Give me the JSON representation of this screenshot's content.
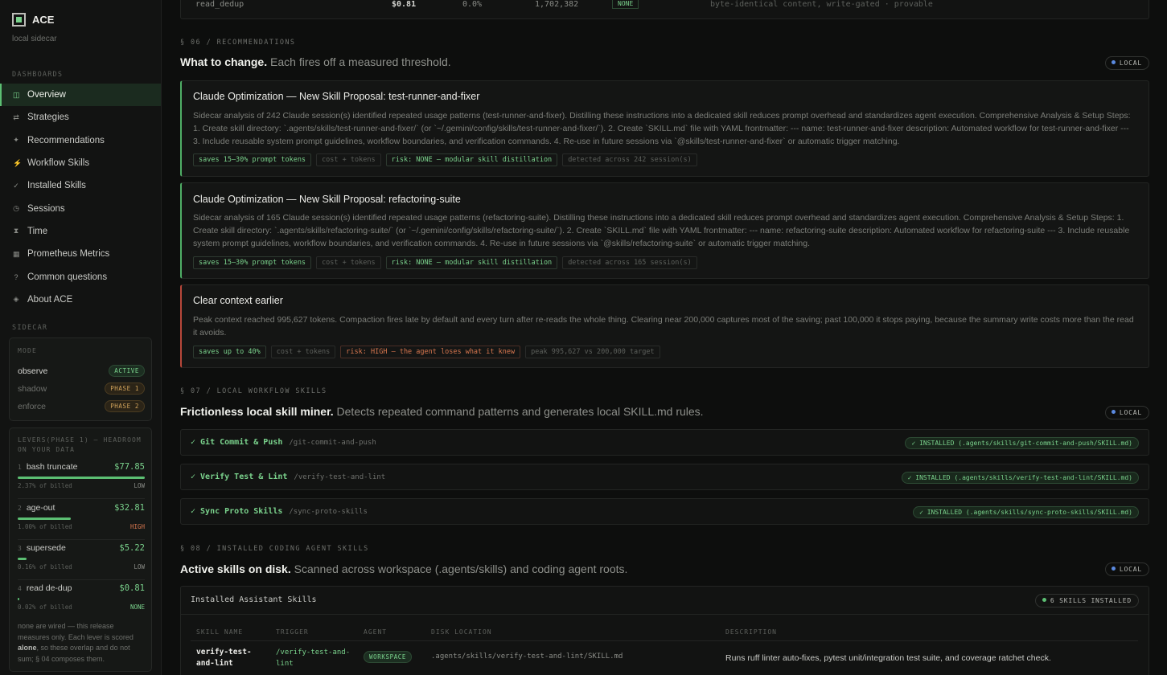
{
  "brand": {
    "title": "ACE",
    "subtitle": "local sidecar"
  },
  "sidebar": {
    "dashboards_label": "DASHBOARDS",
    "items": [
      {
        "label": "Overview",
        "icon": "grid-icon",
        "glyph": "◫"
      },
      {
        "label": "Strategies",
        "icon": "arrows-icon",
        "glyph": "⇄"
      },
      {
        "label": "Recommendations",
        "icon": "sparkle-icon",
        "glyph": "✦"
      },
      {
        "label": "Workflow Skills",
        "icon": "lightning-icon",
        "glyph": "⚡"
      },
      {
        "label": "Installed Skills",
        "icon": "check-icon",
        "glyph": "✓"
      },
      {
        "label": "Sessions",
        "icon": "clock-icon",
        "glyph": "◷"
      },
      {
        "label": "Time",
        "icon": "hourglass-icon",
        "glyph": "⧗"
      },
      {
        "label": "Prometheus Metrics",
        "icon": "bar-chart-icon",
        "glyph": "▦"
      },
      {
        "label": "Common questions",
        "icon": "question-icon",
        "glyph": "?"
      },
      {
        "label": "About ACE",
        "icon": "diamond-icon",
        "glyph": "◈"
      }
    ],
    "sidecar_label": "SIDECAR",
    "mode": {
      "title": "MODE",
      "rows": [
        {
          "label": "observe",
          "badge": "ACTIVE"
        },
        {
          "label": "shadow",
          "badge": "PHASE 1"
        },
        {
          "label": "enforce",
          "badge": "PHASE 2"
        }
      ]
    },
    "levers": {
      "title": "LEVERS(PHASE 1) — HEADROOM ON YOUR DATA",
      "items": [
        {
          "index": "1",
          "name": "bash truncate",
          "value": "$77.85",
          "pct": "2.37% of billed",
          "severity": "LOW",
          "fill": 1.0
        },
        {
          "index": "2",
          "name": "age-out",
          "value": "$32.81",
          "pct": "1.00% of billed",
          "severity": "HIGH",
          "fill": 0.42
        },
        {
          "index": "3",
          "name": "supersede",
          "value": "$5.22",
          "pct": "0.16% of billed",
          "severity": "LOW",
          "fill": 0.07
        },
        {
          "index": "4",
          "name": "read de-dup",
          "value": "$0.81",
          "pct": "0.02% of billed",
          "severity": "NONE",
          "fill": 0.01
        }
      ],
      "note_1": "none are wired — this release measures only. Each lever is scored ",
      "note_bold": "alone",
      "note_2": ", so these overlap and do not sum; § 04 composes them."
    }
  },
  "top_row": {
    "name": "read_dedup",
    "value": "$0.81",
    "pct": "0.0%",
    "count": "1,702,382",
    "badge": "NONE",
    "desc": "byte-identical content, write-gated · provable"
  },
  "recommendations": {
    "label": "§ 06 / RECOMMENDATIONS",
    "title": "What to change.",
    "subtitle": " Each fires off a measured threshold.",
    "pill": "LOCAL",
    "cards": [
      {
        "title": "Claude Optimization — New Skill Proposal: test-runner-and-fixer",
        "body": "Sidecar analysis of 242 Claude session(s) identified repeated usage patterns (test-runner-and-fixer). Distilling these instructions into a dedicated skill reduces prompt overhead and standardizes agent execution. Comprehensive Analysis & Setup Steps: 1. Create skill directory: `.agents/skills/test-runner-and-fixer/` (or `~/.gemini/config/skills/test-runner-and-fixer/`). 2. Create `SKILL.md` file with YAML frontmatter: --- name: test-runner-and-fixer description: Automated workflow for test-runner-and-fixer --- 3. Include reusable system prompt guidelines, workflow boundaries, and verification commands. 4. Re-use in future sessions via `@skills/test-runner-and-fixer` or automatic trigger matching.",
        "tags": [
          "saves 15–30% prompt tokens",
          "cost + tokens",
          "risk: NONE — modular skill distillation",
          "detected across 242 session(s)"
        ]
      },
      {
        "title": "Claude Optimization — New Skill Proposal: refactoring-suite",
        "body": "Sidecar analysis of 165 Claude session(s) identified repeated usage patterns (refactoring-suite). Distilling these instructions into a dedicated skill reduces prompt overhead and standardizes agent execution. Comprehensive Analysis & Setup Steps: 1. Create skill directory: `.agents/skills/refactoring-suite/` (or `~/.gemini/config/skills/refactoring-suite/`). 2. Create `SKILL.md` file with YAML frontmatter: --- name: refactoring-suite description: Automated workflow for refactoring-suite --- 3. Include reusable system prompt guidelines, workflow boundaries, and verification commands. 4. Re-use in future sessions via `@skills/refactoring-suite` or automatic trigger matching.",
        "tags": [
          "saves 15–30% prompt tokens",
          "cost + tokens",
          "risk: NONE — modular skill distillation",
          "detected across 165 session(s)"
        ]
      },
      {
        "title": "Clear context earlier",
        "body": "Peak context reached 995,627 tokens. Compaction fires late by default and every turn after re-reads the whole thing. Clearing near 200,000 captures most of the saving; past 100,000 it stops paying, because the summary write costs more than the read it avoids.",
        "tags": [
          "saves up to 40%",
          "cost + tokens",
          "risk: HIGH — the agent loses what it knew",
          "peak 995,627 vs 200,000 target"
        ]
      }
    ]
  },
  "workflow_skills": {
    "label": "§ 07 / LOCAL WORKFLOW SKILLS",
    "title": "Frictionless local skill miner.",
    "subtitle": " Detects repeated command patterns and generates local SKILL.md rules.",
    "pill": "LOCAL",
    "rows": [
      {
        "name": "✓ Git Commit & Push",
        "cmd": "/git-commit-and-push",
        "status": "✓ INSTALLED (.agents/skills/git-commit-and-push/SKILL.md)"
      },
      {
        "name": "✓ Verify Test & Lint",
        "cmd": "/verify-test-and-lint",
        "status": "✓ INSTALLED (.agents/skills/verify-test-and-lint/SKILL.md)"
      },
      {
        "name": "✓ Sync Proto Skills",
        "cmd": "/sync-proto-skills",
        "status": "✓ INSTALLED (.agents/skills/sync-proto-skills/SKILL.md)"
      }
    ]
  },
  "installed_skills": {
    "label": "§ 08 / INSTALLED CODING AGENT SKILLS",
    "title": "Active skills on disk.",
    "subtitle": " Scanned across workspace (.agents/skills) and coding agent roots.",
    "pill": "LOCAL",
    "card_title": "Installed Assistant Skills",
    "count": "6 SKILLS INSTALLED",
    "columns": [
      "SKILL NAME",
      "TRIGGER",
      "AGENT",
      "DISK LOCATION",
      "DESCRIPTION"
    ],
    "rows": [
      {
        "name": "verify-test-and-lint",
        "trigger": "/verify-test-and-lint",
        "agent": "WORKSPACE",
        "location": ".agents/skills/verify-test-and-lint/SKILL.md",
        "description": "Runs ruff linter auto-fixes, pytest unit/integration test suite, and coverage ratchet check."
      }
    ]
  },
  "colors": {
    "accent": "#5cbf73",
    "danger": "#b8473a",
    "warning": "#d1a35b",
    "background": "#0d0e0d"
  }
}
